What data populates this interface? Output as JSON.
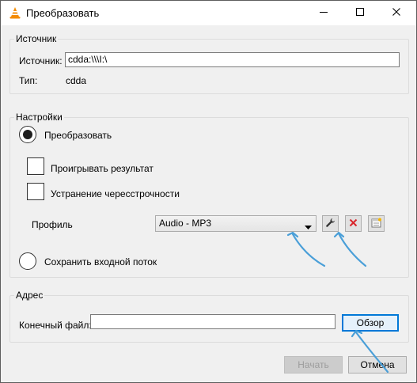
{
  "window": {
    "title": "Преобразовать",
    "app_icon": "vlc-cone-icon",
    "controls": [
      "minimize-icon",
      "maximize-icon",
      "close-icon"
    ]
  },
  "source": {
    "group_title": "Источник",
    "source_label": "Источник:",
    "source_value": "cdda:\\\\\\I:\\",
    "type_label": "Тип:",
    "type_value": "cdda"
  },
  "settings": {
    "group_title": "Настройки",
    "convert_label": "Преобразовать",
    "convert_selected": true,
    "play_result_label": "Проигрывать результат",
    "play_result_checked": false,
    "deinterlace_label": "Устранение чересстрочности",
    "deinterlace_checked": false,
    "profile_label": "Профиль",
    "profile_value": "Audio - MP3",
    "profile_tools": [
      "wrench-icon",
      "delete-icon",
      "new-profile-icon"
    ],
    "dump_raw_label": "Сохранить входной поток",
    "dump_raw_selected": false
  },
  "destination": {
    "group_title": "Адрес",
    "file_label": "Конечный файл:",
    "file_value": "",
    "browse_label": "Обзор"
  },
  "footer": {
    "start_label": "Начать",
    "start_enabled": false,
    "cancel_label": "Отмена"
  },
  "colors": {
    "annotation_arrow": "#4a9fd8",
    "focus_border": "#0078d7",
    "vlc_orange": "#f48b00",
    "delete_red": "#d9262c"
  }
}
